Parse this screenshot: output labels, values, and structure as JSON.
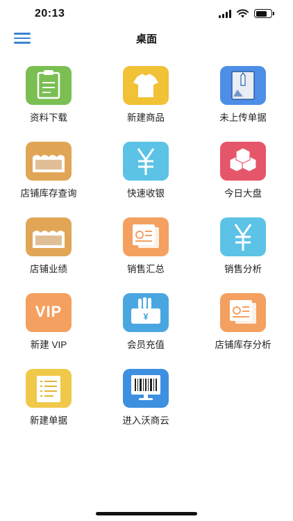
{
  "status": {
    "time": "20:13"
  },
  "nav": {
    "title": "桌面"
  },
  "tiles": [
    {
      "label": "资料下载",
      "icon": "clipboard-icon",
      "color": "#7bbf53"
    },
    {
      "label": "新建商品",
      "icon": "tshirt-icon",
      "color": "#f1c136"
    },
    {
      "label": "未上传单据",
      "icon": "box-upload-icon",
      "color": "#4d8ee6"
    },
    {
      "label": "店铺库存查询",
      "icon": "store-icon",
      "color": "#e0a656"
    },
    {
      "label": "快速收银",
      "icon": "yen-icon",
      "color": "#5cc3e6"
    },
    {
      "label": "今日大盘",
      "icon": "cubes-icon",
      "color": "#e6566b"
    },
    {
      "label": "店铺业绩",
      "icon": "store-icon",
      "color": "#e0a656"
    },
    {
      "label": "销售汇总",
      "icon": "receipt-icon",
      "color": "#f4a060"
    },
    {
      "label": "销售分析",
      "icon": "yen-icon",
      "color": "#5cc3e6"
    },
    {
      "label": "新建 VIP",
      "icon": "vip-icon",
      "color": "#f4a060",
      "icon_text": "VIP"
    },
    {
      "label": "会员充值",
      "icon": "hand-yen-icon",
      "color": "#4aa6e0"
    },
    {
      "label": "店铺库存分析",
      "icon": "receipt-icon",
      "color": "#f4a060"
    },
    {
      "label": "新建单据",
      "icon": "document-list-icon",
      "color": "#f0c94a"
    },
    {
      "label": "进入沃商云",
      "icon": "barcode-monitor-icon",
      "color": "#3d8fe0"
    }
  ]
}
